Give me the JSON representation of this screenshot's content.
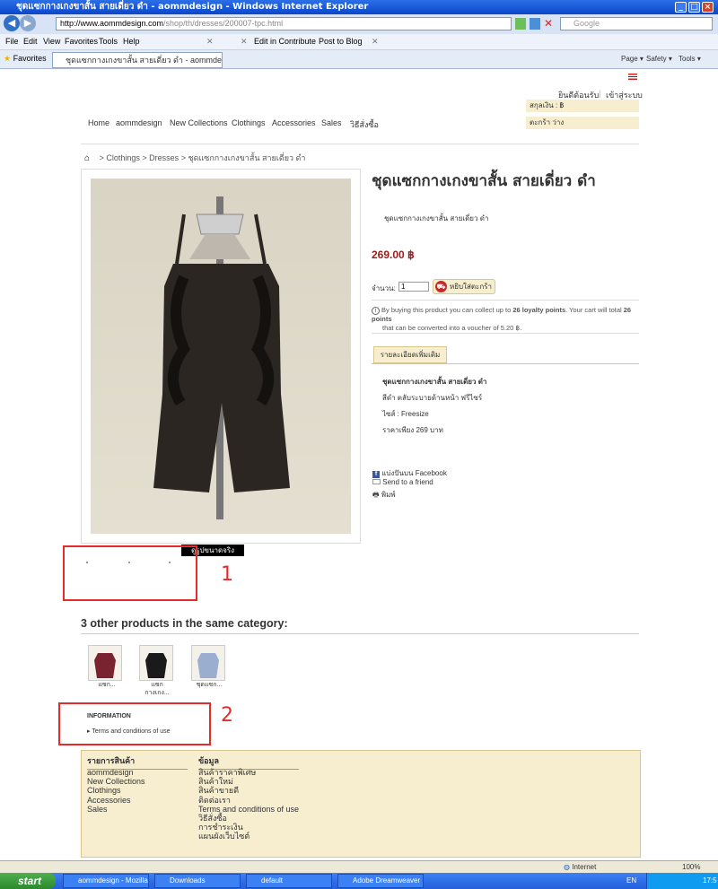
{
  "window": {
    "title": "ชุดแซกกางเกงขาสั้น สายเดี่ยว ดำ - aommdesign - Windows Internet Explorer",
    "url_host": "http://www.aommdesign.com",
    "url_path": "/shop/th/dresses/200007-tpc.html",
    "search_placeholder": "Google"
  },
  "menubar": {
    "items": [
      "File",
      "Edit",
      "View",
      "Favorites",
      "Tools",
      "Help"
    ],
    "edit_in_contribute": "Edit in Contribute",
    "post_to_blog": "Post to Blog"
  },
  "favbar": {
    "favorites": "Favorites",
    "tab_title": "ชุดแซกกางเกงขาสั้น สายเดี่ยว ดำ - aommdesign",
    "page": "Page ▾",
    "safety": "Safety ▾",
    "tools": "Tools ▾"
  },
  "header": {
    "welcome": "ยินดีต้อนรับ",
    "login": "เข้าสู่ระบบ",
    "currency": "สกุลเงิน : ฿",
    "cart": "ตะกร้า ว่าง",
    "nav": [
      "Home",
      "aommdesign",
      "New Collections",
      "Clothings",
      "Accessories",
      "Sales",
      "วิธีสั่งซื้อ"
    ]
  },
  "breadcrumb": {
    "sep": ">",
    "clothings": "Clothings",
    "dresses": "Dresses",
    "current": "ชุดแซกกางเกงขาสั้น สายเดี่ยว ดำ"
  },
  "product": {
    "title": "ชุดแซกกางเกงขาสั้น สายเดี่ยว ดำ",
    "short_desc": "ชุดแซกกางเกงขาสั้น สายเดี่ยว ดำ",
    "price": "269.00 ฿",
    "qty_label": "จำนวน:",
    "qty_value": "1",
    "add_to_cart": "หยิบใส่ตะกร้า",
    "loyalty_1": "By buying this product you can collect up to ",
    "loyalty_points": "26 loyalty points",
    "loyalty_2": ". Your cart will total ",
    "loyalty_total": "26 points",
    "loyalty_3": "that can be converted into a voucher of 5.20 ฿.",
    "more_info_tab": "รายละเอียดเพิ่มเติม",
    "detail_title": "ชุดแซกกางเกงขาสั้น สายเดี่ยว ดำ",
    "detail_color": "สีดำ ตลับระบายด้านหน้า ฟรีไซร์",
    "detail_size": "ไซส์ : Freesize",
    "detail_price": "ราคาเพียง 269 บาท",
    "share_facebook": "แบ่งปันบน Facebook",
    "send_friend": "Send to a friend",
    "print": "พิมพ์",
    "full_size": "ดูรูปขนาดจริง"
  },
  "annotations": {
    "label_1": "1",
    "label_2": "2"
  },
  "related": {
    "heading": "3 other products in the same category:",
    "items": [
      {
        "name": "แซก...",
        "color": "#7a2330"
      },
      {
        "name": "แซก กางเกง...",
        "color": "#1a1a1a"
      },
      {
        "name": "ชุดแซก...",
        "color": "#9aaecf"
      }
    ]
  },
  "information": {
    "heading": "INFORMATION",
    "link": "Terms and conditions of use"
  },
  "footer": {
    "col1_title": "รายการสินค้า",
    "col1": [
      "aommdesign",
      "New Collections",
      "Clothings",
      "Accessories",
      "Sales"
    ],
    "col2_title": "ข้อมูล",
    "col2": [
      "สินค้าราคาพิเศษ",
      "สินค้าใหม่",
      "สินค้าขายดี",
      "ติดต่อเรา",
      "Terms and conditions of use",
      "วิธีสั่งซื้อ",
      "การชำระเงิน",
      "แผนผังเว็บไซต์"
    ]
  },
  "statusbar": {
    "zone": "Internet",
    "zoom": "100%"
  },
  "taskbar": {
    "start": "start",
    "tasks": [
      "aommdesign - Mozilla ...",
      "Downloads",
      "default",
      "Adobe Dreamweaver ..."
    ],
    "lang": "EN",
    "time": "17:5"
  },
  "colors": {
    "accent_red": "#9b1b1b",
    "footer_bg": "#f7eed0",
    "annotation_red": "#e52b2b"
  }
}
